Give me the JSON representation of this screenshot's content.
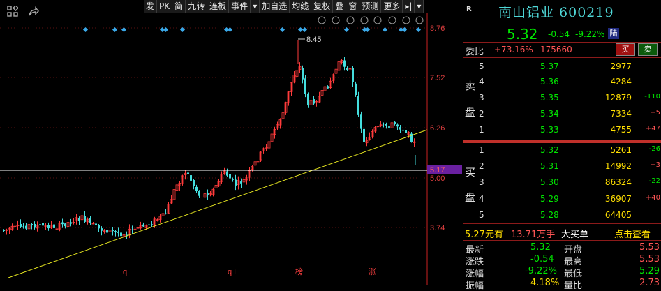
{
  "toolbar": {
    "items": [
      "发",
      "PK",
      "简",
      "九转",
      "连板",
      "事件",
      "▾",
      "加自选",
      "均线",
      "复权",
      "叠",
      "窗",
      "预测",
      "更多",
      "▸|",
      "▾"
    ]
  },
  "chart": {
    "price_labels": {
      "p876": "8.76",
      "p752": "7.52",
      "p626": "6.26",
      "p500": "5.00",
      "p374": "3.74",
      "current": "5.17"
    },
    "high_label": "8.45",
    "markers": [
      "q",
      "q L",
      "榜",
      "涨"
    ],
    "colors": {
      "up": "#ff3b3b",
      "down": "#44dddd",
      "axis": "#cc2222",
      "trend": "#e6e620",
      "marker": "#3aa8e8",
      "price_tag_bg": "#6a20a0"
    }
  },
  "quote": {
    "flag": "R",
    "title": "南山铝业 600219",
    "price": "5.32",
    "change": "-0.54",
    "change_pct": "-9.22%",
    "exchange_badge": "陆",
    "weibi_label": "委比",
    "weibi_pct": "+73.16%",
    "weibi_diff": "175660",
    "buy_btn": "买",
    "sell_btn": "卖"
  },
  "order_book": {
    "sell_side_label": [
      "卖",
      "盘"
    ],
    "buy_side_label": [
      "买",
      "盘"
    ],
    "asks": [
      {
        "level": "5",
        "price": "5.37",
        "vol": "2977",
        "delta": ""
      },
      {
        "level": "4",
        "price": "5.36",
        "vol": "4284",
        "delta": ""
      },
      {
        "level": "3",
        "price": "5.35",
        "vol": "12879",
        "delta": "-110"
      },
      {
        "level": "2",
        "price": "5.34",
        "vol": "7334",
        "delta": "+5"
      },
      {
        "level": "1",
        "price": "5.33",
        "vol": "4755",
        "delta": "+47"
      }
    ],
    "bids": [
      {
        "level": "1",
        "price": "5.32",
        "vol": "5261",
        "delta": "-26"
      },
      {
        "level": "2",
        "price": "5.31",
        "vol": "14992",
        "delta": "+3"
      },
      {
        "level": "3",
        "price": "5.30",
        "vol": "86324",
        "delta": "-22"
      },
      {
        "level": "4",
        "price": "5.29",
        "vol": "36907",
        "delta": "+40"
      },
      {
        "level": "5",
        "price": "5.28",
        "vol": "64405",
        "delta": ""
      }
    ]
  },
  "trade_note": {
    "price_text": "5.27元有",
    "amount": "13.71万手",
    "type": "大买单",
    "link": "点击查看"
  },
  "stats": {
    "last_label": "最新",
    "last": "5.32",
    "open_label": "开盘",
    "open": "5.53",
    "change_label": "涨跌",
    "change": "-0.54",
    "high_label": "最高",
    "high": "5.53",
    "pct_label": "涨幅",
    "pct": "-9.22%",
    "low_label": "最低",
    "low": "5.29",
    "amp_label": "振幅",
    "amp": "4.18%",
    "ratio_label": "量比",
    "ratio": "2.73"
  }
}
